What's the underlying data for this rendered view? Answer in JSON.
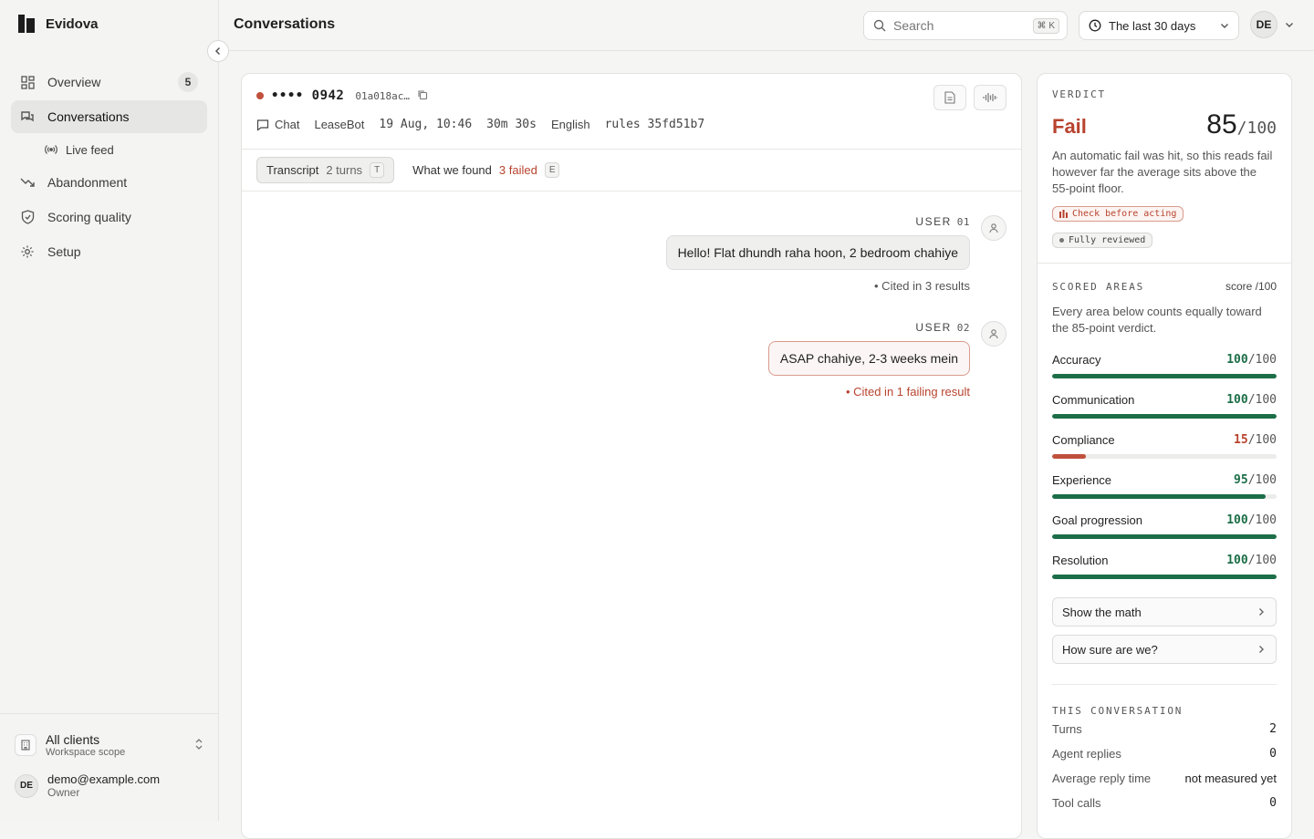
{
  "app": {
    "name": "Evidova"
  },
  "sidebar": {
    "items": [
      {
        "label": "Overview",
        "count": "5"
      },
      {
        "label": "Conversations"
      },
      {
        "label": "Live feed"
      },
      {
        "label": "Abandonment"
      },
      {
        "label": "Scoring quality"
      },
      {
        "label": "Setup"
      }
    ],
    "scope": {
      "title": "All clients",
      "subtitle": "Workspace scope"
    },
    "user": {
      "initials": "DE",
      "email": "demo@example.com",
      "role": "Owner"
    }
  },
  "header": {
    "title": "Conversations",
    "search": {
      "placeholder": "Search",
      "shortcut": "⌘ K"
    },
    "range": "The last 30 days",
    "avatar": "DE"
  },
  "conversation": {
    "id": "•••• 0942",
    "hash": "01a018ac…",
    "meta": {
      "channel": "Chat",
      "bot": "LeaseBot",
      "datetime": "19 Aug, 10:46",
      "duration": "30m 30s",
      "language": "English",
      "rules": "rules 35fd51b7"
    },
    "tabs": [
      {
        "label": "Transcript",
        "count": "2 turns",
        "key": "T"
      },
      {
        "label": "What we found",
        "count": "3 failed",
        "key": "E"
      }
    ],
    "messages": [
      {
        "role": "USER",
        "num": "01",
        "text": "Hello! Flat dhundh raha hoon, 2 bedroom chahiye",
        "cite": "• Cited in  3  results",
        "failing": false
      },
      {
        "role": "USER",
        "num": "02",
        "text": "ASAP chahiye, 2-3 weeks mein",
        "cite": "• Cited in  1  failing result",
        "failing": true
      }
    ]
  },
  "verdict": {
    "label": "VERDICT",
    "result": "Fail",
    "score": "85",
    "score_den": "/100",
    "description": "An automatic fail was hit, so this reads fail however far the average sits above the 55-point floor.",
    "pills": [
      "Check before acting",
      "Fully reviewed"
    ],
    "areas_label": "SCORED AREAS",
    "areas_unit": "score /100",
    "areas_desc": "Every area below counts equally toward the 85-point verdict.",
    "areas": [
      {
        "name": "Accuracy",
        "score": "100",
        "den": "/100",
        "value": 100,
        "status": "good"
      },
      {
        "name": "Communication",
        "score": "100",
        "den": "/100",
        "value": 100,
        "status": "good"
      },
      {
        "name": "Compliance",
        "score": "15",
        "den": "/100",
        "value": 15,
        "status": "bad"
      },
      {
        "name": "Experience",
        "score": "95",
        "den": "/100",
        "value": 95,
        "status": "good"
      },
      {
        "name": "Goal progression",
        "score": "100",
        "den": "/100",
        "value": 100,
        "status": "good"
      },
      {
        "name": "Resolution",
        "score": "100",
        "den": "/100",
        "value": 100,
        "status": "good"
      }
    ],
    "buttons": [
      "Show the math",
      "How sure are we?"
    ],
    "stats_label": "THIS CONVERSATION",
    "stats": [
      {
        "label": "Turns",
        "value": "2"
      },
      {
        "label": "Agent replies",
        "value": "0"
      },
      {
        "label": "Average reply time",
        "value": "not measured yet"
      },
      {
        "label": "Tool calls",
        "value": "0"
      }
    ]
  },
  "colors": {
    "good": "#1c6e48",
    "bad": "#b8432e"
  }
}
